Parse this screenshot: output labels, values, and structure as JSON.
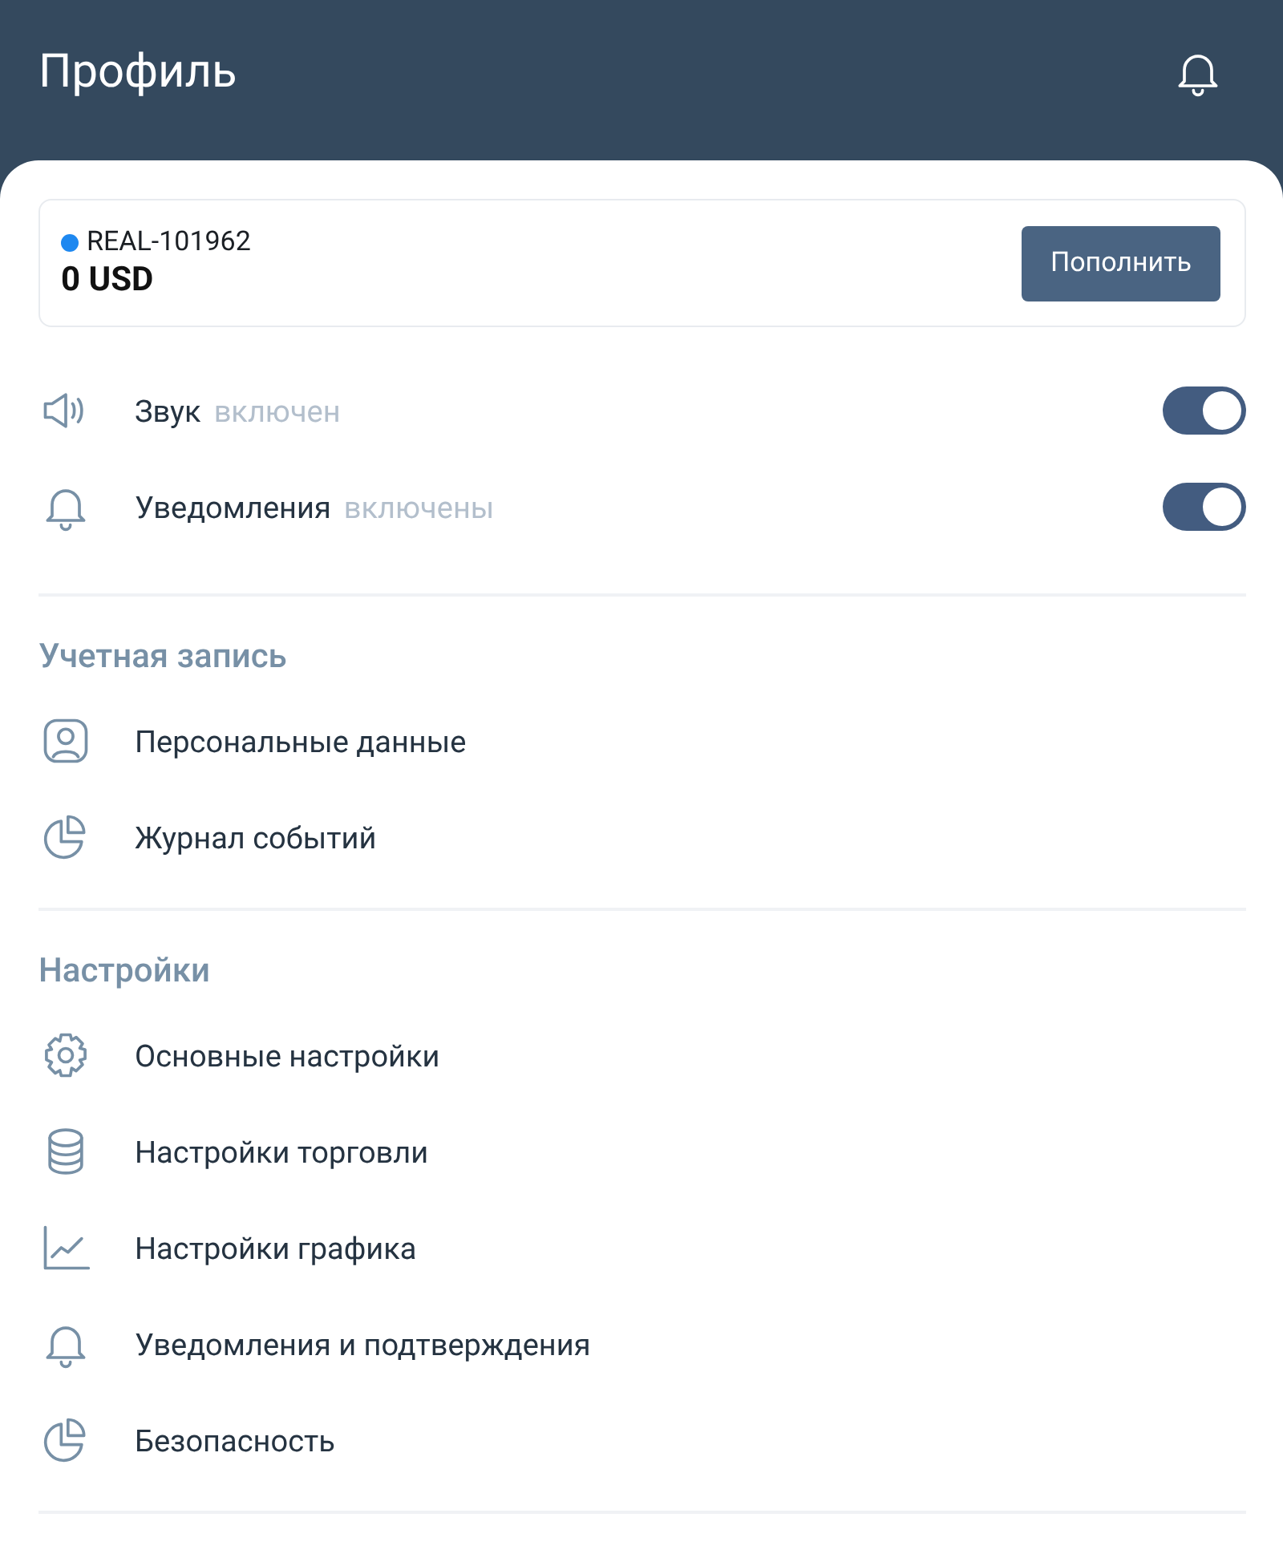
{
  "header": {
    "title": "Профиль"
  },
  "account": {
    "id": "REAL-101962",
    "color": "#1e88f0",
    "balance": "0 USD",
    "button": "Пополнить"
  },
  "toggles": [
    {
      "label": "Звук",
      "status": "включен",
      "on": true
    },
    {
      "label": "Уведомления",
      "status": "включены",
      "on": true
    }
  ],
  "sections": [
    {
      "title": "Учетная запись",
      "items": [
        "Персональные данные",
        "Журнал событий"
      ]
    },
    {
      "title": "Настройки",
      "items": [
        "Основные настройки",
        "Настройки торговли",
        "Настройки графика",
        "Уведомления и подтверждения",
        "Безопасность"
      ]
    }
  ]
}
